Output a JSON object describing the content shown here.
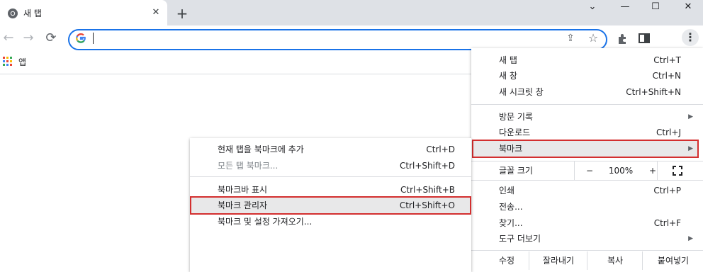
{
  "tab": {
    "title": "새 탭",
    "close_icon": "close-icon"
  },
  "window": {
    "minimize": "—",
    "maximize": "☐",
    "close": "✕",
    "collapse": "⌄"
  },
  "toolbar": {
    "back": "←",
    "forward": "→",
    "reload": "⟳",
    "omnibox_value": ""
  },
  "bookmarks_bar": {
    "apps_label": "앱"
  },
  "main_menu": {
    "items": [
      {
        "label": "새 탭",
        "shortcut": "Ctrl+T"
      },
      {
        "label": "새 창",
        "shortcut": "Ctrl+N"
      },
      {
        "label": "새 시크릿 창",
        "shortcut": "Ctrl+Shift+N"
      },
      {
        "label": "방문 기록",
        "shortcut": ""
      },
      {
        "label": "다운로드",
        "shortcut": "Ctrl+J"
      },
      {
        "label": "북마크",
        "shortcut": ""
      },
      {
        "label": "인쇄",
        "shortcut": "Ctrl+P"
      },
      {
        "label": "전송...",
        "shortcut": ""
      },
      {
        "label": "찾기...",
        "shortcut": "Ctrl+F"
      },
      {
        "label": "도구 더보기",
        "shortcut": ""
      }
    ],
    "zoom": {
      "label": "글꼴 크기",
      "minus": "−",
      "value": "100%",
      "plus": "+"
    },
    "edit": {
      "label": "수정",
      "cut": "잘라내기",
      "copy": "복사",
      "paste": "붙여넣기"
    }
  },
  "bookmark_submenu": {
    "items": [
      {
        "label": "현재 탭을 북마크에 추가",
        "shortcut": "Ctrl+D"
      },
      {
        "label": "모든 탭 북마크...",
        "shortcut": "Ctrl+Shift+D"
      },
      {
        "label": "북마크바 표시",
        "shortcut": "Ctrl+Shift+B"
      },
      {
        "label": "북마크 관리자",
        "shortcut": "Ctrl+Shift+O"
      },
      {
        "label": "북마크 및 설정 가져오기...",
        "shortcut": ""
      }
    ]
  },
  "colors": {
    "accent": "#1a73e8",
    "highlight_outline": "#d32f2f",
    "tabstrip": "#dee1e6"
  }
}
